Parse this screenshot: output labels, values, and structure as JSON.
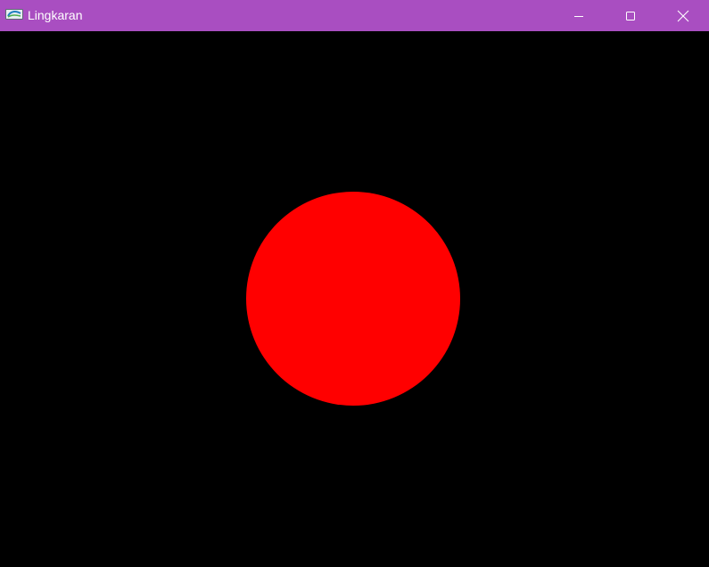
{
  "window": {
    "title": "Lingkaran",
    "app_icon": "opengl-app-icon",
    "titlebar_color": "#a94ec1",
    "title_text_color": "#ffffff",
    "controls": {
      "minimize_icon": "minimize-icon",
      "maximize_icon": "maximize-icon",
      "close_icon": "close-icon"
    }
  },
  "canvas": {
    "background_color": "#000000",
    "shape": "circle",
    "fill_color": "#ff0000"
  }
}
